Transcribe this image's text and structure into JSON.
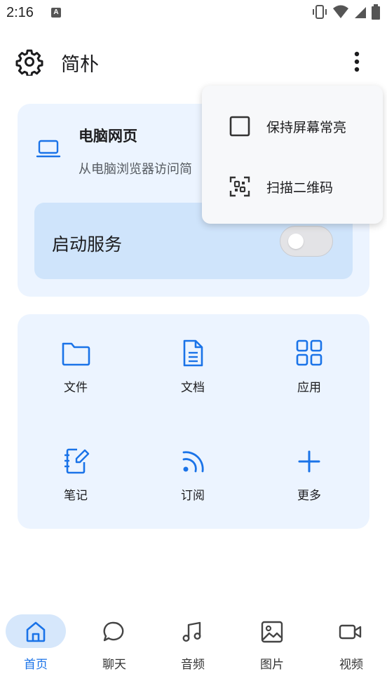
{
  "status_bar": {
    "time": "2:16",
    "a_badge": "A"
  },
  "topbar": {
    "title": "简朴",
    "settings_icon": "gear-icon",
    "more_icon": "more-vert-icon"
  },
  "web_card": {
    "title": "电脑网页",
    "subtitle": "从电脑浏览器访问简",
    "icon": "laptop-icon",
    "service_label": "启动服务",
    "service_on": false
  },
  "grid": {
    "items": [
      {
        "label": "文件",
        "icon": "folder-icon"
      },
      {
        "label": "文档",
        "icon": "document-icon"
      },
      {
        "label": "应用",
        "icon": "apps-icon"
      },
      {
        "label": "笔记",
        "icon": "notebook-icon"
      },
      {
        "label": "订阅",
        "icon": "rss-icon"
      },
      {
        "label": "更多",
        "icon": "plus-icon"
      }
    ]
  },
  "menu": {
    "items": [
      {
        "label": "保持屏幕常亮",
        "icon": "checkbox-icon",
        "checked": false
      },
      {
        "label": "扫描二维码",
        "icon": "qr-scan-icon"
      }
    ]
  },
  "bottom_nav": {
    "items": [
      {
        "label": "首页",
        "icon": "home-icon",
        "active": true
      },
      {
        "label": "聊天",
        "icon": "chat-icon"
      },
      {
        "label": "音频",
        "icon": "music-icon"
      },
      {
        "label": "图片",
        "icon": "image-icon"
      },
      {
        "label": "视频",
        "icon": "video-icon"
      }
    ]
  },
  "colors": {
    "accent": "#1a73e8",
    "card_bg": "#ecf4ff",
    "service_bg": "#cfe4fb",
    "nav_pill": "#d6e7fb"
  }
}
